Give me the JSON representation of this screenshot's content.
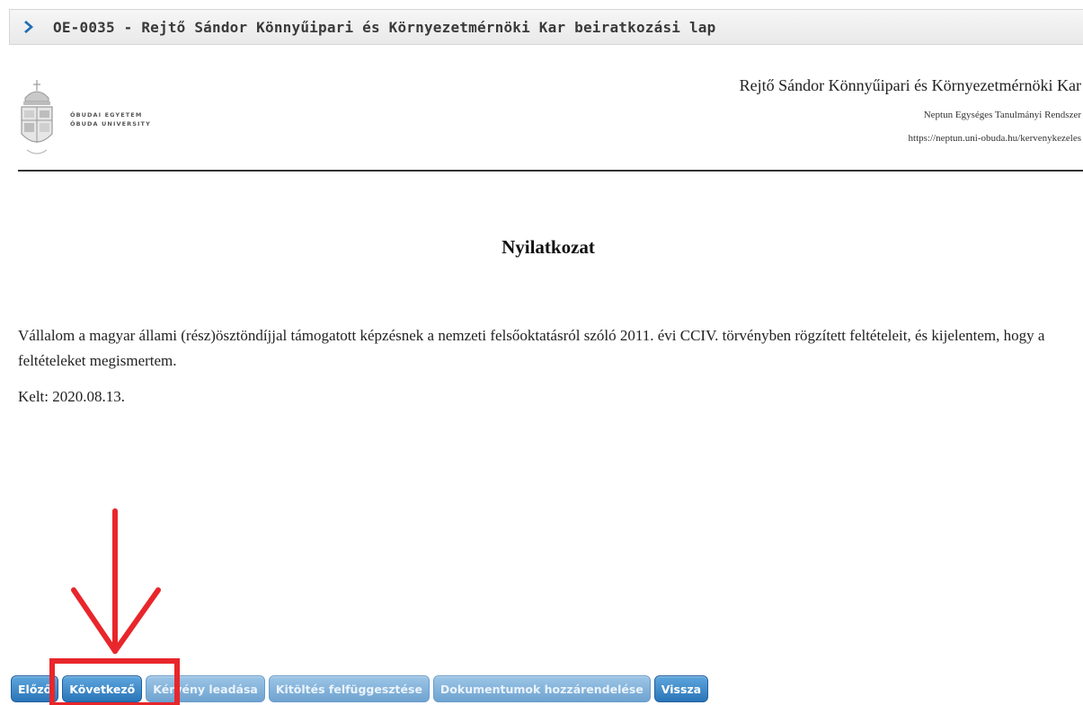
{
  "window": {
    "title": "OE-0035 - Rejtő Sándor Könnyűipari és Környezetmérnöki Kar beiratkozási lap"
  },
  "header": {
    "logo_line1": "ÓBUDAI EGYETEM",
    "logo_line2": "ÓBUDA UNIVERSITY",
    "faculty": "Rejtő Sándor Könnyűipari és Környezetmérnöki Kar",
    "system": "Neptun Egységes Tanulmányi Rendszer",
    "url": "https://neptun.uni-obuda.hu/kervenykezeles"
  },
  "document": {
    "heading": "Nyilatkozat",
    "paragraph": "Vállalom a magyar állami (rész)ösztöndíjjal támogatott képzésnek a nemzeti felsőoktatásról szóló 2011. évi CCIV. törvényben rögzített feltételeit, és kijelentem, hogy a feltételeket megismertem.",
    "date": "Kelt: 2020.08.13."
  },
  "buttons": {
    "prev": "Előző",
    "next": "Következő",
    "submit": "Kérvény leadása",
    "suspend": "Kitöltés felfüggesztése",
    "attach": "Dokumentumok hozzárendelése",
    "back": "Vissza"
  },
  "colors": {
    "button": "#2a75b8",
    "annotation": "#e8262b",
    "chevron": "#1e6fb3"
  },
  "icons": {
    "title_chevron": "chevron-right-icon",
    "logo": "university-crest-icon"
  }
}
